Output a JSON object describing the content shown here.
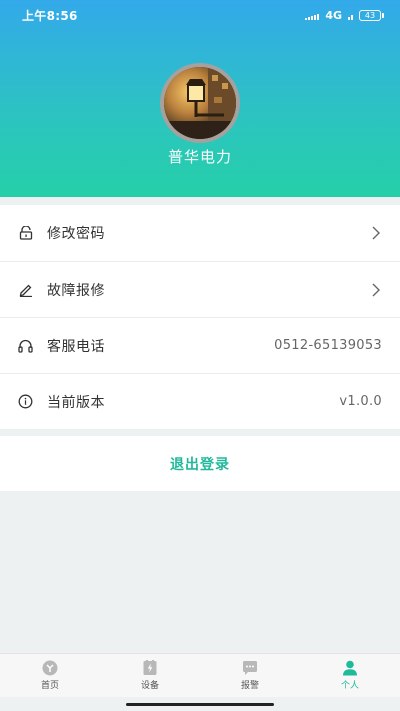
{
  "status_bar": {
    "time": "上午8:56",
    "network": "4G",
    "battery": "43"
  },
  "profile": {
    "name": "普华电力"
  },
  "menu": {
    "items": [
      {
        "label": "修改密码",
        "icon": "lock-icon",
        "value": "",
        "has_arrow": true
      },
      {
        "label": "故障报修",
        "icon": "edit-icon",
        "value": "",
        "has_arrow": true
      },
      {
        "label": "客服电话",
        "icon": "headphones-icon",
        "value": "0512-65139053",
        "has_arrow": false
      },
      {
        "label": "当前版本",
        "icon": "info-icon",
        "value": "v1.0.0",
        "has_arrow": false
      }
    ]
  },
  "logout": {
    "label": "退出登录"
  },
  "tabbar": {
    "tabs": [
      {
        "label": "首页",
        "icon": "home-icon",
        "active": false
      },
      {
        "label": "设备",
        "icon": "device-icon",
        "active": false
      },
      {
        "label": "报警",
        "icon": "alarm-message-icon",
        "active": false
      },
      {
        "label": "个人",
        "icon": "person-icon",
        "active": true
      }
    ]
  },
  "colors": {
    "accent": "#22b99a",
    "header_top": "#33a9ea",
    "header_bottom": "#25d0a8"
  }
}
